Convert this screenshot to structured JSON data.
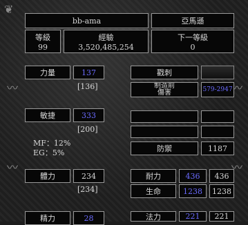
{
  "header": {
    "character_name": "bb-ama",
    "character_class": "亞馬遜",
    "level_label": "等級",
    "level_value": "99",
    "experience_label": "經驗",
    "experience_value": "3,520,485,254",
    "next_level_label": "下一等級",
    "next_level_value": "0"
  },
  "attributes": {
    "strength": {
      "label": "力量",
      "value": "137",
      "base": "[136]"
    },
    "dexterity": {
      "label": "敏捷",
      "value": "333",
      "base": "[200]"
    },
    "vitality": {
      "label": "體力",
      "value": "234",
      "base": "[234]"
    },
    "energy": {
      "label": "精力",
      "value": "28"
    }
  },
  "bonuses": {
    "mf": "MF：12%",
    "eg": "EG：5%"
  },
  "combat": {
    "attack_label": "戳刺",
    "damage_label_1": "制造前",
    "damage_label_2": "傷害",
    "damage_value": "579-2947",
    "defense_label": "防禦",
    "defense_value": "1187",
    "stamina_label": "耐力",
    "stamina_current": "436",
    "stamina_max": "436",
    "life_label": "生命",
    "life_current": "1238",
    "life_max": "1238",
    "mana_label": "法力",
    "mana_current": "221",
    "mana_max": "221"
  },
  "colors": {
    "highlight_blue": "#6b6bff",
    "box_border": "#9a9a9a",
    "box_bg": "#070707"
  }
}
